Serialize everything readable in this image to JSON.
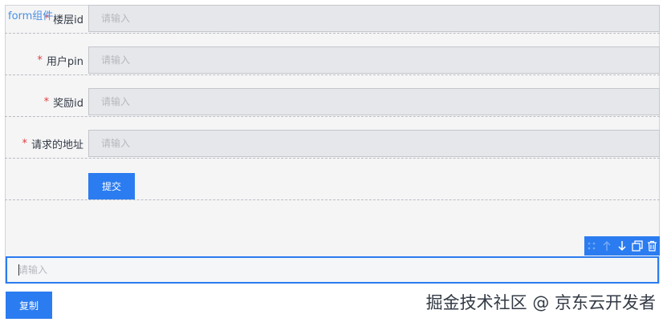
{
  "form": {
    "title": "form组件",
    "fields": [
      {
        "required": "*",
        "label": "楼层id",
        "placeholder": "请输入"
      },
      {
        "required": "*",
        "label": "用户pin",
        "placeholder": "请输入"
      },
      {
        "required": "*",
        "label": "奖励id",
        "placeholder": "请输入"
      },
      {
        "required": "*",
        "label": "请求的地址",
        "placeholder": "请输入"
      }
    ],
    "submit_label": "提交"
  },
  "toolbar": {
    "icons": [
      "drag-handle-icon",
      "arrow-up-icon",
      "arrow-down-icon",
      "copy-icon",
      "trash-icon"
    ]
  },
  "selected_input": {
    "placeholder": "请输入"
  },
  "copy_button": {
    "label": "复制"
  },
  "watermark": {
    "text": "掘金技术社区 @ 京东云开发者"
  },
  "colors": {
    "accent": "#2b7cf0",
    "required": "#e04040",
    "canvas": "#f5f5f6"
  }
}
